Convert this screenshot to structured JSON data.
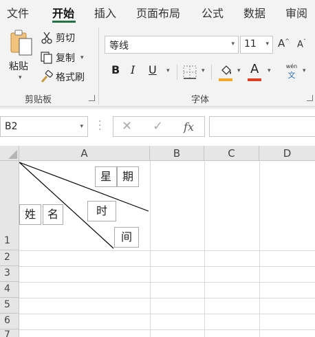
{
  "menu": {
    "tabs": [
      {
        "label": "文件"
      },
      {
        "label": "开始"
      },
      {
        "label": "插入"
      },
      {
        "label": "页面布局"
      },
      {
        "label": "公式"
      },
      {
        "label": "数据"
      },
      {
        "label": "审阅"
      }
    ],
    "active_tab": "开始"
  },
  "ribbon": {
    "clipboard": {
      "paste_label": "粘贴",
      "cut_label": "剪切",
      "copy_label": "复制",
      "format_painter_label": "格式刷",
      "group_label": "剪贴板"
    },
    "font": {
      "font_name": "等线",
      "font_size": "11",
      "grow_label": "A",
      "shrink_label": "A",
      "bold_label": "B",
      "italic_label": "I",
      "underline_label": "U",
      "font_color_label": "A",
      "phonetic_top": "wén",
      "phonetic_bottom": "文",
      "group_label": "字体",
      "fill_color": "#f5a623",
      "font_color": "#e03c1e"
    }
  },
  "formula_bar": {
    "name_box": "B2",
    "cancel_icon": "close-icon",
    "enter_icon": "check-icon",
    "fx_label": "fx",
    "formula_value": ""
  },
  "grid": {
    "columns": [
      "A",
      "B",
      "C",
      "D"
    ],
    "rows": [
      "1",
      "2",
      "3",
      "4",
      "5",
      "6",
      "7"
    ],
    "cell_A1_textboxes": [
      "星",
      "期",
      "时",
      "姓",
      "名",
      "间"
    ]
  },
  "colors": {
    "accent": "#217346",
    "ribbon_bg": "#f3f3f3",
    "header_bg": "#e6e6e6"
  }
}
